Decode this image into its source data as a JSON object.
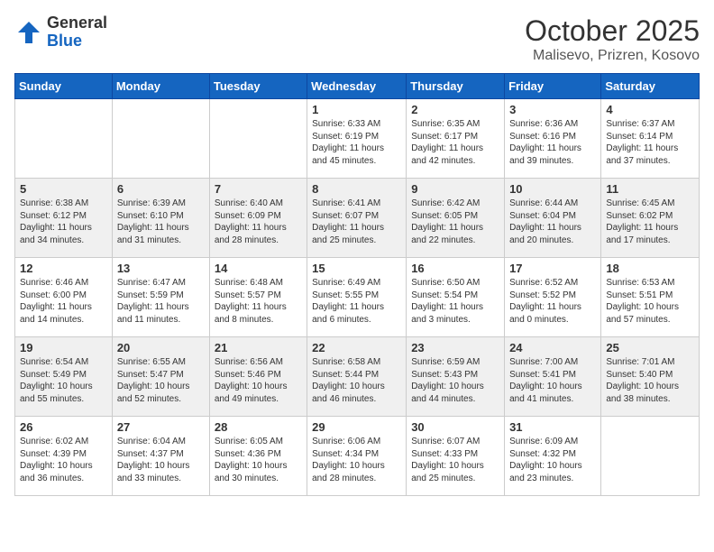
{
  "header": {
    "logo_general": "General",
    "logo_blue": "Blue",
    "month": "October 2025",
    "location": "Malisevo, Prizren, Kosovo"
  },
  "days_of_week": [
    "Sunday",
    "Monday",
    "Tuesday",
    "Wednesday",
    "Thursday",
    "Friday",
    "Saturday"
  ],
  "weeks": [
    [
      {
        "day": "",
        "content": ""
      },
      {
        "day": "",
        "content": ""
      },
      {
        "day": "",
        "content": ""
      },
      {
        "day": "1",
        "content": "Sunrise: 6:33 AM\nSunset: 6:19 PM\nDaylight: 11 hours\nand 45 minutes."
      },
      {
        "day": "2",
        "content": "Sunrise: 6:35 AM\nSunset: 6:17 PM\nDaylight: 11 hours\nand 42 minutes."
      },
      {
        "day": "3",
        "content": "Sunrise: 6:36 AM\nSunset: 6:16 PM\nDaylight: 11 hours\nand 39 minutes."
      },
      {
        "day": "4",
        "content": "Sunrise: 6:37 AM\nSunset: 6:14 PM\nDaylight: 11 hours\nand 37 minutes."
      }
    ],
    [
      {
        "day": "5",
        "content": "Sunrise: 6:38 AM\nSunset: 6:12 PM\nDaylight: 11 hours\nand 34 minutes."
      },
      {
        "day": "6",
        "content": "Sunrise: 6:39 AM\nSunset: 6:10 PM\nDaylight: 11 hours\nand 31 minutes."
      },
      {
        "day": "7",
        "content": "Sunrise: 6:40 AM\nSunset: 6:09 PM\nDaylight: 11 hours\nand 28 minutes."
      },
      {
        "day": "8",
        "content": "Sunrise: 6:41 AM\nSunset: 6:07 PM\nDaylight: 11 hours\nand 25 minutes."
      },
      {
        "day": "9",
        "content": "Sunrise: 6:42 AM\nSunset: 6:05 PM\nDaylight: 11 hours\nand 22 minutes."
      },
      {
        "day": "10",
        "content": "Sunrise: 6:44 AM\nSunset: 6:04 PM\nDaylight: 11 hours\nand 20 minutes."
      },
      {
        "day": "11",
        "content": "Sunrise: 6:45 AM\nSunset: 6:02 PM\nDaylight: 11 hours\nand 17 minutes."
      }
    ],
    [
      {
        "day": "12",
        "content": "Sunrise: 6:46 AM\nSunset: 6:00 PM\nDaylight: 11 hours\nand 14 minutes."
      },
      {
        "day": "13",
        "content": "Sunrise: 6:47 AM\nSunset: 5:59 PM\nDaylight: 11 hours\nand 11 minutes."
      },
      {
        "day": "14",
        "content": "Sunrise: 6:48 AM\nSunset: 5:57 PM\nDaylight: 11 hours\nand 8 minutes."
      },
      {
        "day": "15",
        "content": "Sunrise: 6:49 AM\nSunset: 5:55 PM\nDaylight: 11 hours\nand 6 minutes."
      },
      {
        "day": "16",
        "content": "Sunrise: 6:50 AM\nSunset: 5:54 PM\nDaylight: 11 hours\nand 3 minutes."
      },
      {
        "day": "17",
        "content": "Sunrise: 6:52 AM\nSunset: 5:52 PM\nDaylight: 11 hours\nand 0 minutes."
      },
      {
        "day": "18",
        "content": "Sunrise: 6:53 AM\nSunset: 5:51 PM\nDaylight: 10 hours\nand 57 minutes."
      }
    ],
    [
      {
        "day": "19",
        "content": "Sunrise: 6:54 AM\nSunset: 5:49 PM\nDaylight: 10 hours\nand 55 minutes."
      },
      {
        "day": "20",
        "content": "Sunrise: 6:55 AM\nSunset: 5:47 PM\nDaylight: 10 hours\nand 52 minutes."
      },
      {
        "day": "21",
        "content": "Sunrise: 6:56 AM\nSunset: 5:46 PM\nDaylight: 10 hours\nand 49 minutes."
      },
      {
        "day": "22",
        "content": "Sunrise: 6:58 AM\nSunset: 5:44 PM\nDaylight: 10 hours\nand 46 minutes."
      },
      {
        "day": "23",
        "content": "Sunrise: 6:59 AM\nSunset: 5:43 PM\nDaylight: 10 hours\nand 44 minutes."
      },
      {
        "day": "24",
        "content": "Sunrise: 7:00 AM\nSunset: 5:41 PM\nDaylight: 10 hours\nand 41 minutes."
      },
      {
        "day": "25",
        "content": "Sunrise: 7:01 AM\nSunset: 5:40 PM\nDaylight: 10 hours\nand 38 minutes."
      }
    ],
    [
      {
        "day": "26",
        "content": "Sunrise: 6:02 AM\nSunset: 4:39 PM\nDaylight: 10 hours\nand 36 minutes."
      },
      {
        "day": "27",
        "content": "Sunrise: 6:04 AM\nSunset: 4:37 PM\nDaylight: 10 hours\nand 33 minutes."
      },
      {
        "day": "28",
        "content": "Sunrise: 6:05 AM\nSunset: 4:36 PM\nDaylight: 10 hours\nand 30 minutes."
      },
      {
        "day": "29",
        "content": "Sunrise: 6:06 AM\nSunset: 4:34 PM\nDaylight: 10 hours\nand 28 minutes."
      },
      {
        "day": "30",
        "content": "Sunrise: 6:07 AM\nSunset: 4:33 PM\nDaylight: 10 hours\nand 25 minutes."
      },
      {
        "day": "31",
        "content": "Sunrise: 6:09 AM\nSunset: 4:32 PM\nDaylight: 10 hours\nand 23 minutes."
      },
      {
        "day": "",
        "content": ""
      }
    ]
  ]
}
